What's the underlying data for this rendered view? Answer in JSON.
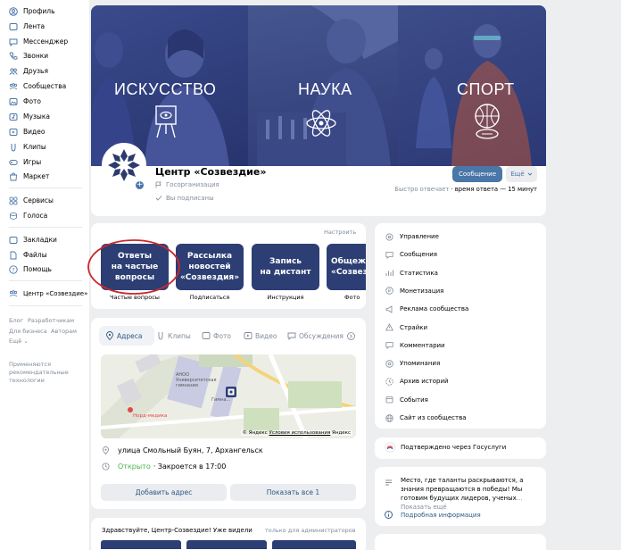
{
  "sidebar": {
    "items": [
      {
        "label": "Профиль",
        "icon": "profile-icon"
      },
      {
        "label": "Лента",
        "icon": "news-icon"
      },
      {
        "label": "Мессенджер",
        "icon": "messenger-icon"
      },
      {
        "label": "Звонки",
        "icon": "phone-icon"
      },
      {
        "label": "Друзья",
        "icon": "friends-icon"
      },
      {
        "label": "Сообщества",
        "icon": "communities-icon"
      },
      {
        "label": "Фото",
        "icon": "photo-icon"
      },
      {
        "label": "Музыка",
        "icon": "music-icon"
      },
      {
        "label": "Видео",
        "icon": "video-icon"
      },
      {
        "label": "Клипы",
        "icon": "clips-icon"
      },
      {
        "label": "Игры",
        "icon": "games-icon"
      },
      {
        "label": "Маркет",
        "icon": "market-icon"
      },
      {
        "label": "Сервисы",
        "icon": "services-icon"
      },
      {
        "label": "Голоса",
        "icon": "votes-icon"
      },
      {
        "label": "Закладки",
        "icon": "bookmarks-icon"
      },
      {
        "label": "Файлы",
        "icon": "files-icon"
      },
      {
        "label": "Помощь",
        "icon": "help-icon"
      },
      {
        "label": "Центр «Созвездие»",
        "icon": "community-shortcut-icon"
      }
    ],
    "footer_links": {
      "blog": "Блог",
      "developers": "Разработчикам",
      "business": "Для бизнеса",
      "authors": "Авторам",
      "more": "Ещё ⌄"
    },
    "recommendation_note": "Применяются рекомендательные технологии"
  },
  "cover": {
    "titles": [
      "ИСКУССТВО",
      "НАУКА",
      "СПОРТ"
    ]
  },
  "community": {
    "name": "Центр «Созвездие»",
    "type": "Госорганизация",
    "subscribed": "Вы подписаны",
    "message_button": "Сообщение",
    "more_button": "Ещё",
    "response_label": "Быстро отвечает",
    "response_time": "· время ответа — 15 минут"
  },
  "widgets": {
    "configure": "Настроить",
    "tiles": [
      {
        "title": "Ответы\nна частые\nвопросы",
        "caption": "Частые вопросы"
      },
      {
        "title": "Рассылка\nновостей\n«Созвездия»",
        "caption": "Подписаться"
      },
      {
        "title": "Запись\nна дистант",
        "caption": "Инструкция"
      },
      {
        "title": "Общеж\n«Созвез",
        "caption": "Фото"
      }
    ]
  },
  "tabs": [
    "Адреса",
    "Клипы",
    "Фото",
    "Видео",
    "Обсуждения"
  ],
  "map": {
    "label_school": "АНОО Университетская гимназия",
    "label_med": "Норд-медика",
    "label_gym": "Гимна...",
    "attribution_brand": "© Яндекс",
    "attribution_terms": "Условия использования",
    "attribution_tail": "Яндекс"
  },
  "address": {
    "street": "улица Смольный Буян, 7, Архангельск",
    "status_open": "Открыто",
    "status_close": "· Закроется в 17:00",
    "add_button": "Добавить адрес",
    "show_all_button": "Показать все 1"
  },
  "post_preview": {
    "text": "Здравствуйте, Центр-Созвездие! Уже видели",
    "admins_only": "только для администраторов"
  },
  "manage_menu": [
    {
      "label": "Управление",
      "icon": "settings-icon"
    },
    {
      "label": "Сообщения",
      "icon": "message-icon"
    },
    {
      "label": "Статистика",
      "icon": "stats-icon"
    },
    {
      "label": "Монетизация",
      "icon": "money-icon"
    },
    {
      "label": "Реклама сообщества",
      "icon": "ads-icon"
    },
    {
      "label": "Страйки",
      "icon": "warning-icon"
    },
    {
      "label": "Комментарии",
      "icon": "comment-icon"
    },
    {
      "label": "Упоминания",
      "icon": "mention-icon"
    },
    {
      "label": "Архив историй",
      "icon": "archive-icon"
    },
    {
      "label": "События",
      "icon": "events-icon"
    },
    {
      "label": "Сайт из сообщества",
      "icon": "globe-icon"
    }
  ],
  "gosuslugi": "Подтверждено через Госуслуги",
  "about": {
    "text": "Место, где таланты раскрываются, а знания превращаются в победы! Мы готовим будущих лидеров, ученых",
    "show_more": "... Показать ещё",
    "detail_link": "Подробная информация"
  },
  "colors": {
    "accent": "#4a76a8",
    "cover_overlay": "#2c3a78",
    "tile": "#2c3e73",
    "open_green": "#4bb34b",
    "highlight_circle": "#c8292f"
  }
}
